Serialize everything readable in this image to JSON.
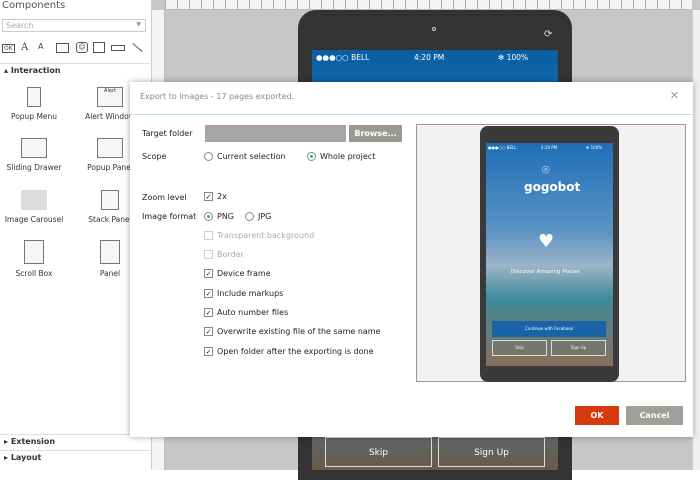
{
  "left": {
    "title": "Components",
    "search_placeholder": "Search",
    "sections": [
      "Interaction",
      "Extension",
      "Layout"
    ],
    "components": [
      {
        "label": "Popup Menu"
      },
      {
        "label": "Alert Window",
        "badge": "Alert"
      },
      {
        "label": "Sliding Drawer"
      },
      {
        "label": "Popup Panel"
      },
      {
        "label": "Image Carousel"
      },
      {
        "label": "Stack Panel"
      },
      {
        "label": "Scroll Box"
      },
      {
        "label": "Panel"
      }
    ],
    "tools": [
      "OK",
      "A",
      "A"
    ]
  },
  "device": {
    "carrier": "●●●○○ BELL",
    "time": "4:20 PM",
    "battery": "✻ 100%",
    "skip": "Skip",
    "signup": "Sign Up"
  },
  "dialog": {
    "title": "Export to images - 17 pages exported.",
    "close": "✕",
    "target_label": "Target folder",
    "target_value": "",
    "browse": "Browse...",
    "scope_label": "Scope",
    "scope_current": "Current selection",
    "scope_whole": "Whole project",
    "zoom_label": "Zoom level",
    "zoom_value": "2x",
    "format_label": "Image format",
    "png": "PNG",
    "jpg": "JPG",
    "options": [
      {
        "label": "Transparent background",
        "checked": false,
        "disabled": true
      },
      {
        "label": "Border",
        "checked": false,
        "disabled": true
      },
      {
        "label": "Device frame",
        "checked": true
      },
      {
        "label": "Include markups",
        "checked": true
      },
      {
        "label": "Auto number files",
        "checked": true
      },
      {
        "label": "Overwrite existing file of the same name",
        "checked": true
      },
      {
        "label": "Open folder after the exporting is done",
        "checked": true
      }
    ],
    "ok": "OK",
    "cancel": "Cancel"
  },
  "preview": {
    "carrier": "●●●○○ BELL",
    "time": "4:20 PM",
    "battery": "✻ 100%",
    "brand": "gogobot",
    "tagline": "Discover Amazing Places",
    "facebook": "Continue with Facebook",
    "skip": "Skip",
    "signup": "Sign Up"
  }
}
